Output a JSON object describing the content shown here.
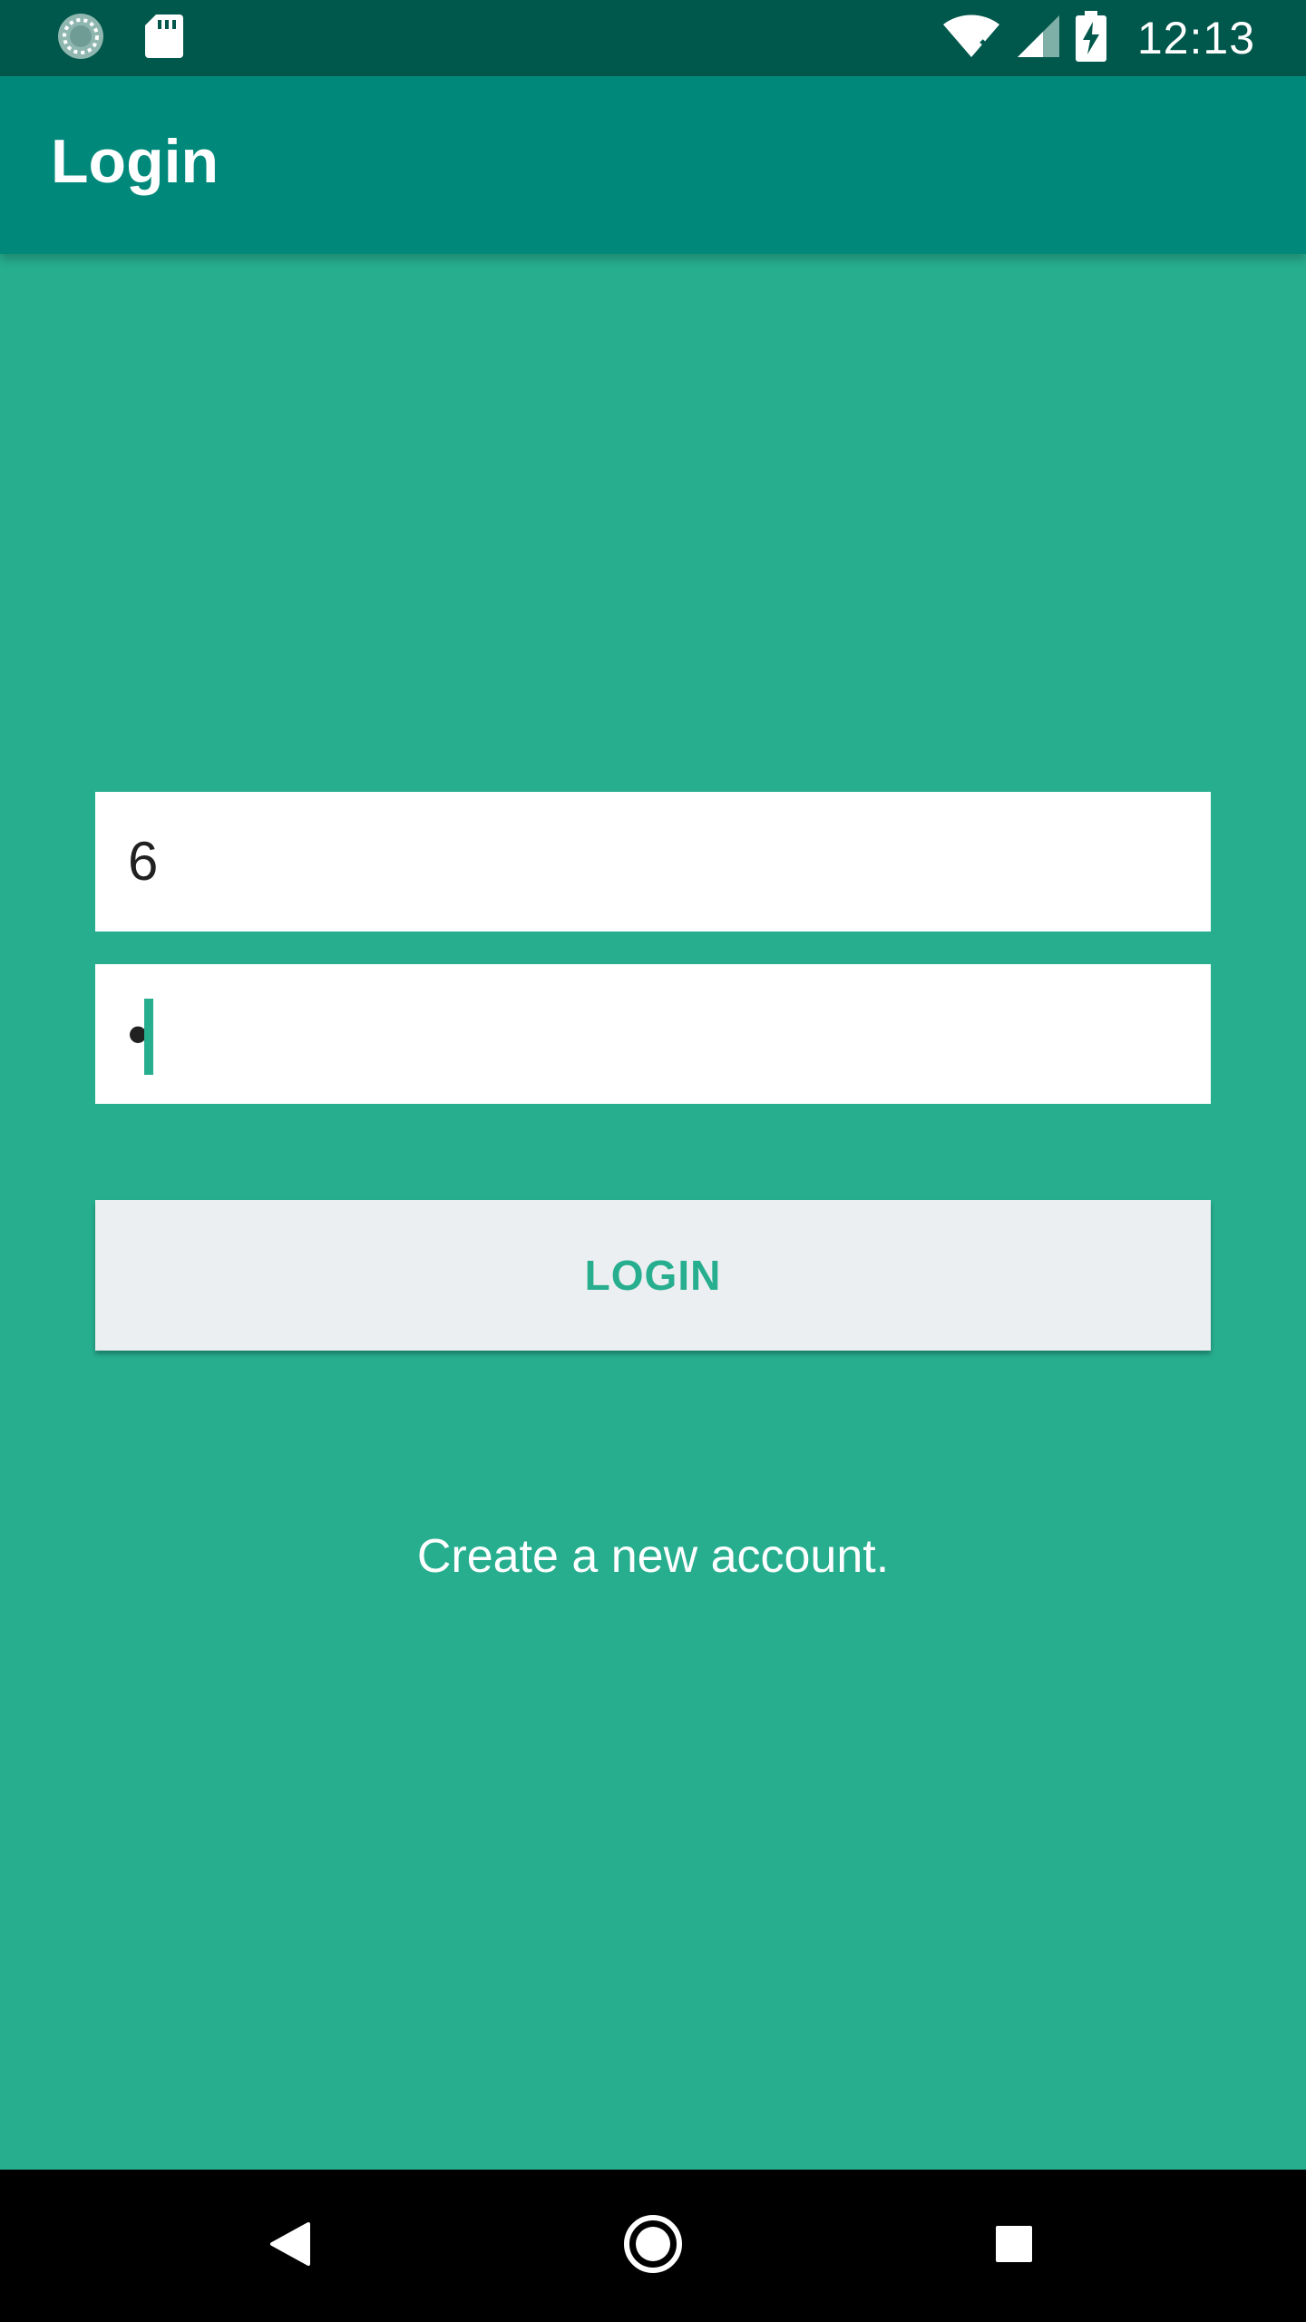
{
  "status_bar": {
    "time": "12:13",
    "icons": [
      "sync-icon",
      "sd-card-icon",
      "wifi-icon",
      "signal-icon",
      "battery-charging-icon"
    ]
  },
  "app_bar": {
    "title": "Login"
  },
  "form": {
    "username_value": "6",
    "password_value": "•"
  },
  "login_button": {
    "label": "LOGIN"
  },
  "create_account": {
    "label": "Create a new account."
  },
  "nav_bar": {
    "icons": [
      "back-icon",
      "home-icon",
      "recents-icon"
    ]
  },
  "colors": {
    "background": "#27ae8f",
    "app_bar": "#00897b",
    "status_bar": "#00574b",
    "button_background": "#eceff1",
    "button_text": "#27ae8f"
  }
}
